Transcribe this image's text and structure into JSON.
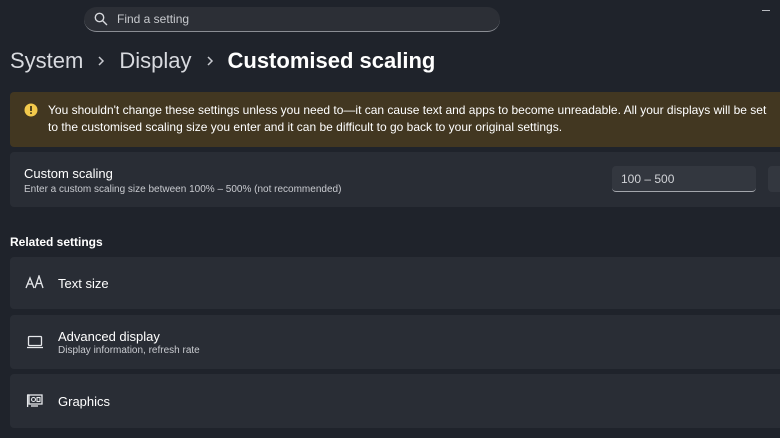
{
  "search": {
    "placeholder": "Find a setting",
    "icon": "search-icon"
  },
  "breadcrumb": {
    "items": [
      "System",
      "Display",
      "Customised scaling"
    ]
  },
  "warning": {
    "icon": "warning-icon",
    "text": "You shouldn't change these settings unless you need to—it can cause text and apps to become unreadable. All your displays will be set to the customised scaling size you enter and it can be difficult to go back to your original settings."
  },
  "custom_scaling": {
    "title": "Custom scaling",
    "description": "Enter a custom scaling size between 100% – 500% (not recommended)",
    "input_placeholder": "100 – 500"
  },
  "related": {
    "title": "Related settings",
    "items": [
      {
        "label": "Text size",
        "icon": "text-size-icon"
      },
      {
        "label": "Advanced display",
        "sublabel": "Display information, refresh rate",
        "icon": "monitor-icon"
      },
      {
        "label": "Graphics",
        "icon": "graphics-card-icon"
      }
    ]
  },
  "colors": {
    "background": "#1f232b",
    "card": "#292d35",
    "warning_bg": "#423721",
    "warning_icon": "#f2c94c"
  }
}
